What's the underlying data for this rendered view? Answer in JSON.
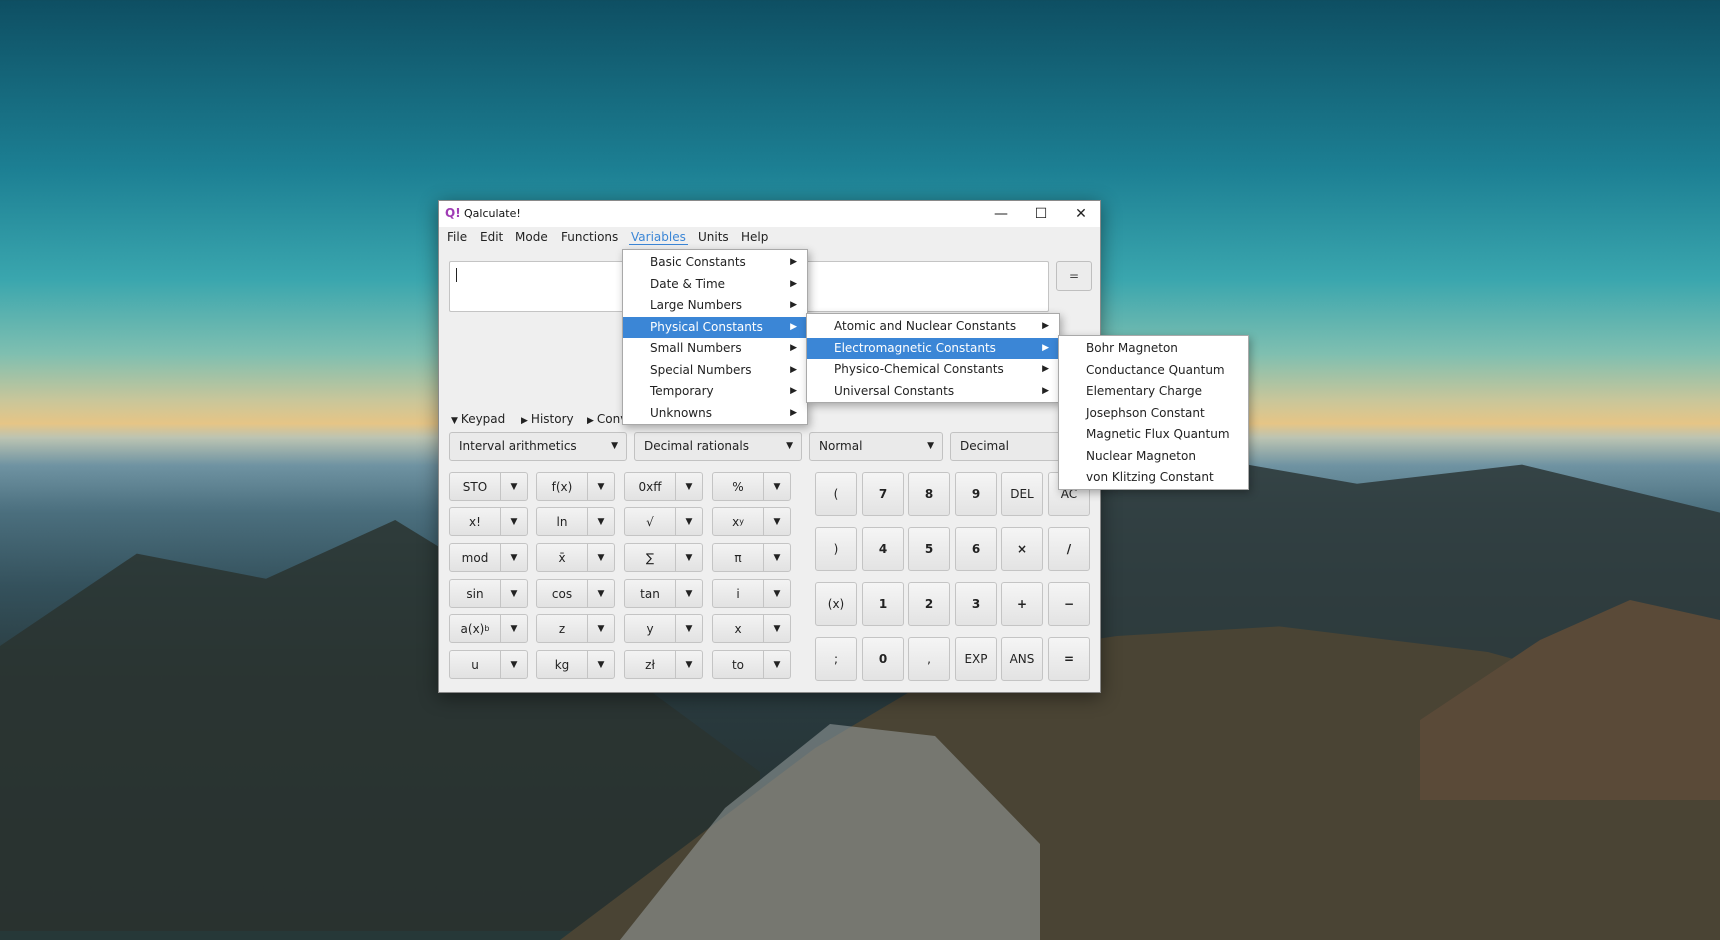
{
  "window": {
    "title": "Qalculate!",
    "minimize": "—",
    "maximize": "☐",
    "close": "✕"
  },
  "menubar": [
    "File",
    "Edit",
    "Mode",
    "Functions",
    "Variables",
    "Units",
    "Help"
  ],
  "expression": {
    "value": ""
  },
  "equals_button": "=",
  "expanders": {
    "keypad": "Keypad",
    "history": "History",
    "conversion": "Conv"
  },
  "selectors": {
    "interval": "Interval arithmetics",
    "rationals": "Decimal rationals",
    "display": "Normal",
    "base": "Decimal"
  },
  "keypad_left": [
    [
      "STO",
      "f(x)",
      "0xff",
      "%"
    ],
    [
      "x!",
      "ln",
      "√",
      "x^y"
    ],
    [
      "mod",
      "x̄",
      "∑",
      "π"
    ],
    [
      "sin",
      "cos",
      "tan",
      "i"
    ],
    [
      "a(x)^b",
      "z",
      "y",
      "x"
    ],
    [
      "u",
      "kg",
      "zł",
      "to"
    ]
  ],
  "keypad_right": [
    [
      "(",
      "7",
      "8",
      "9",
      "DEL",
      "AC"
    ],
    [
      ")",
      "4",
      "5",
      "6",
      "×",
      "/"
    ],
    [
      "(x)",
      "1",
      "2",
      "3",
      "+",
      "−"
    ],
    [
      ";",
      "0",
      ",",
      "EXP",
      "ANS",
      "="
    ]
  ],
  "variables_menu": [
    "Basic Constants",
    "Date & Time",
    "Large Numbers",
    "Physical Constants",
    "Small Numbers",
    "Special Numbers",
    "Temporary",
    "Unknowns"
  ],
  "physical_constants_menu": [
    "Atomic and Nuclear Constants",
    "Electromagnetic Constants",
    "Physico-Chemical Constants",
    "Universal Constants"
  ],
  "electromagnetic_menu": [
    "Bohr Magneton",
    "Conductance Quantum",
    "Elementary Charge",
    "Josephson Constant",
    "Magnetic Flux Quantum",
    "Nuclear Magneton",
    "von Klitzing Constant"
  ],
  "colors": {
    "accent": "#3b86d6",
    "icon": "#a03cb5"
  }
}
